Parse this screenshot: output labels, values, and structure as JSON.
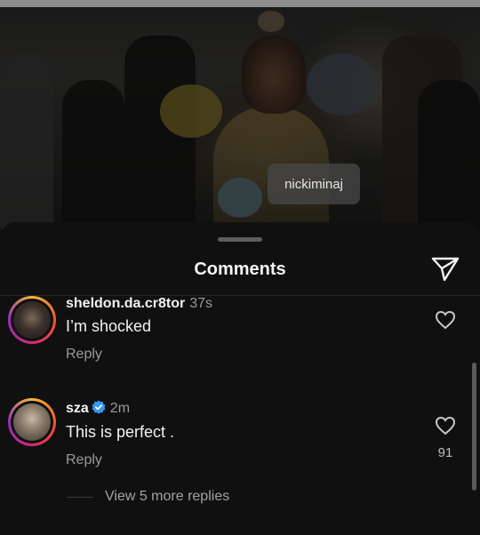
{
  "video": {
    "tag_label": "nickiminaj"
  },
  "sheet": {
    "title": "Comments",
    "share_icon": "paper-plane-icon"
  },
  "comments": [
    {
      "username": "sheldon.da.cr8tor",
      "time": "37s",
      "text": "I’m shocked",
      "reply_label": "Reply",
      "like_icon": "heart-outline-icon",
      "likes": ""
    },
    {
      "username": "sza",
      "verified": true,
      "time": "2m",
      "text": "This is perfect .",
      "reply_label": "Reply",
      "like_icon": "heart-outline-icon",
      "likes": "91"
    }
  ],
  "view_more_replies": "View 5 more replies",
  "colors": {
    "background": "#101010",
    "text": "#f2f2f2",
    "muted": "#9a9a9a",
    "verified": "#3897f0",
    "story_ring": [
      "#f7b733",
      "#f2582b",
      "#d62976",
      "#962fbf"
    ]
  }
}
